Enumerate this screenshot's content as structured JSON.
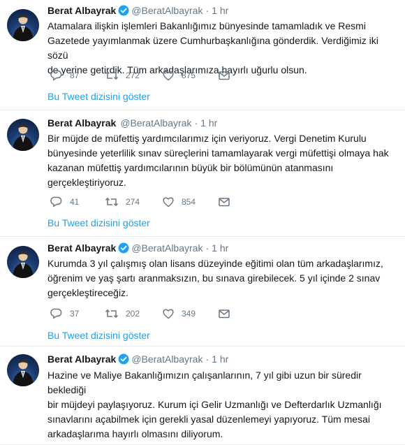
{
  "colors": {
    "accent": "#1da1f2",
    "muted": "#657786",
    "text": "#14171a",
    "divider": "#e6ecf0"
  },
  "tweets": [
    {
      "name": "Berat Albayrak",
      "handle": "@BeratAlbayrak",
      "separator": "·",
      "time": "1 hr",
      "text": "Atamalara ilişkin işlemleri Bakanlığımız bünyesinde tamamladık ve Resmi\nGazetede yayımlanmak üzere  Cumhurbaşkanlığına gönderdik. Verdiğimiz iki sözü\nde yerine getirdik. Tüm arkadaşlarımıza hayırlı uğurlu olsun.",
      "replies": "87",
      "retweets": "272",
      "likes": "875",
      "thread_link": "Bu Tweet dizisini göster"
    },
    {
      "name": "Berat Albayrak",
      "handle": "@BeratAlbayrak",
      "separator": "·",
      "time": "1 hr",
      "text": "Bir müjde de müfettiş yardımcılarımız için veriyoruz. Vergi Denetim Kurulu\nbünyesinde yeterlilik sınav süreçlerini tamamlayarak vergi müfettişi olmaya hak\nkazanan müfettiş yardımcılarının büyük bir bölümünün atanmasını\ngerçekleştiriyoruz.",
      "replies": "41",
      "retweets": "274",
      "likes": "854",
      "thread_link": "Bu Tweet dizisini göster"
    },
    {
      "name": "Berat Albayrak",
      "handle": "@BeratAlbayrak",
      "separator": "·",
      "time": "1 hr",
      "text": "Kurumda 3 yıl çalışmış olan lisans düzeyinde eğitimi olan tüm arkadaşlarımız,\nöğrenim ve yaş şartı aranmaksızın, bu sınava girebilecek. 5 yıl içinde 2 sınav\ngerçekleştireceğiz.",
      "replies": "37",
      "retweets": "202",
      "likes": "349",
      "thread_link": "Bu Tweet dizisini göster"
    },
    {
      "name": "Berat Albayrak",
      "handle": "@BeratAlbayrak",
      "separator": "·",
      "time": "1 hr",
      "text": "Hazine ve Maliye Bakanlığımızın çalışanlarının, 7 yıl gibi uzun bir süredir beklediği\nbir müjdeyi paylaşıyoruz. Kurum içi Gelir Uzmanlığı ve Defterdarlık Uzmanlığı\nsınavlarını açabilmek için gerekli yasal düzenlemeyi yapıyoruz.  Tüm mesai\narkadaşlarıma hayırlı olmasını diliyorum."
    }
  ]
}
